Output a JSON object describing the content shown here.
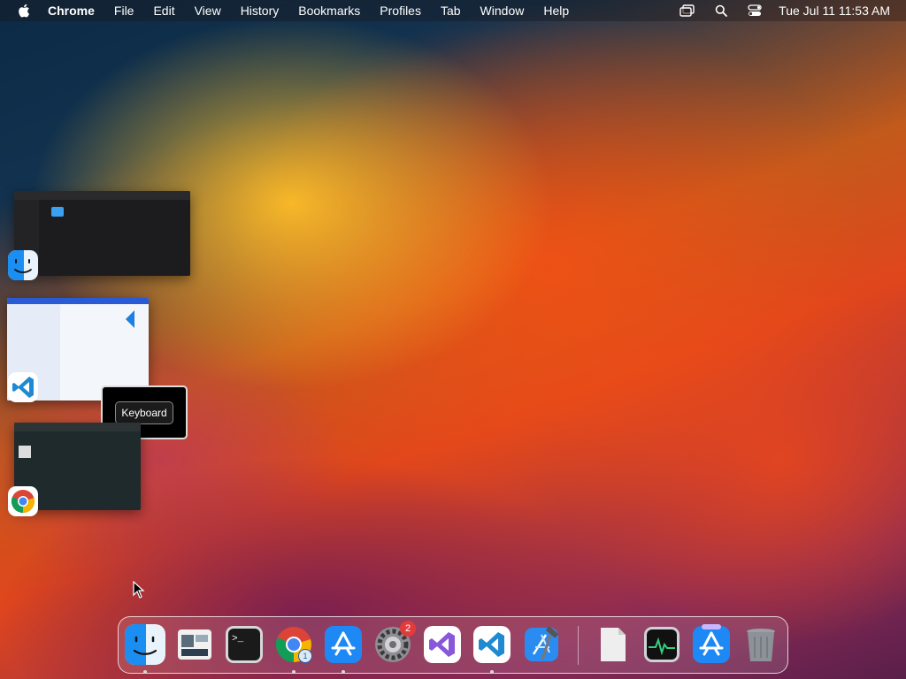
{
  "menubar": {
    "app_name": "Chrome",
    "items": [
      "File",
      "Edit",
      "View",
      "History",
      "Bookmarks",
      "Profiles",
      "Tab",
      "Window",
      "Help"
    ],
    "clock": "Tue Jul 11  11:53 AM",
    "icons": [
      "apple-icon",
      "screen-mirroring-icon",
      "spotlight-search-icon",
      "control-center-icon"
    ]
  },
  "switcher": {
    "windows": [
      {
        "app": "Finder",
        "icon": "finder-icon"
      },
      {
        "app": "Visual Studio Code",
        "icon": "vscode-icon"
      },
      {
        "app": "Google Chrome",
        "icon": "chrome-icon"
      }
    ]
  },
  "tooltip": {
    "label": "Keyboard"
  },
  "dock": {
    "items": [
      {
        "name": "Finder",
        "icon": "finder-icon",
        "running": true
      },
      {
        "name": "Window Manager",
        "icon": "window-manager-icon",
        "running": false
      },
      {
        "name": "Terminal",
        "icon": "terminal-icon",
        "running": false
      },
      {
        "name": "Google Chrome",
        "icon": "chrome-icon",
        "running": true,
        "badge": "1"
      },
      {
        "name": "App Store",
        "icon": "app-store-icon",
        "running": true
      },
      {
        "name": "System Settings",
        "icon": "gear-icon",
        "running": false,
        "badge": "2"
      },
      {
        "name": "Visual Studio",
        "icon": "visual-studio-icon",
        "running": false
      },
      {
        "name": "Visual Studio Code",
        "icon": "vscode-icon",
        "running": true
      },
      {
        "name": "Xcode",
        "icon": "xcode-icon",
        "running": false
      },
      {
        "name": "Document",
        "icon": "document-icon",
        "running": false
      },
      {
        "name": "Activity Monitor",
        "icon": "activity-monitor-icon",
        "running": false
      },
      {
        "name": "App Store Beta",
        "icon": "app-store-beta-icon",
        "running": false
      },
      {
        "name": "Trash",
        "icon": "trash-icon",
        "running": false
      }
    ]
  }
}
